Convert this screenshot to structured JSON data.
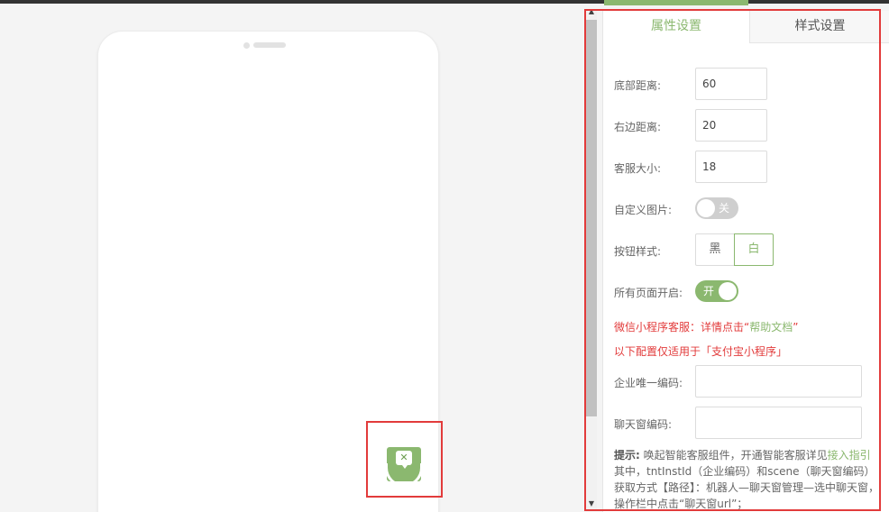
{
  "tabs": {
    "attributes": "属性设置",
    "style": "样式设置"
  },
  "form": {
    "bottom_distance": {
      "label": "底部距离:",
      "value": "60"
    },
    "right_distance": {
      "label": "右边距离:",
      "value": "20"
    },
    "service_size": {
      "label": "客服大小:",
      "value": "18"
    },
    "custom_image": {
      "label": "自定义图片:",
      "toggle_text": "关",
      "state": "off"
    },
    "button_style": {
      "label": "按钮样式:",
      "options": [
        "黑",
        "白"
      ],
      "selected": "白"
    },
    "all_pages": {
      "label": "所有页面开启:",
      "toggle_text": "开",
      "state": "on"
    }
  },
  "notes": {
    "wechat_prefix": "微信小程序客服：详情点击“",
    "wechat_link": "帮助文档",
    "wechat_suffix": "”",
    "alipay_only": "以下配置仅适用于「支付宝小程序」"
  },
  "alipay": {
    "enterprise_code": {
      "label": "企业唯一编码:",
      "value": ""
    },
    "chat_window_code": {
      "label": "聊天窗编码:",
      "value": ""
    }
  },
  "tip": {
    "label": "提示:",
    "text_1": "唤起智能客服组件，开通智能客服详见",
    "link": "接入指引",
    "text_2": "其中，tntInstId（企业编码）和scene（聊天窗编码）获取方式【路径】：机器人—聊天窗管理—选中聊天窗，操作栏中点击“聊天窗url”；"
  },
  "preview": {
    "cs_icon": "customer-service-icon"
  },
  "colors": {
    "accent": "#8bb86f",
    "highlight": "#e23b3b"
  }
}
